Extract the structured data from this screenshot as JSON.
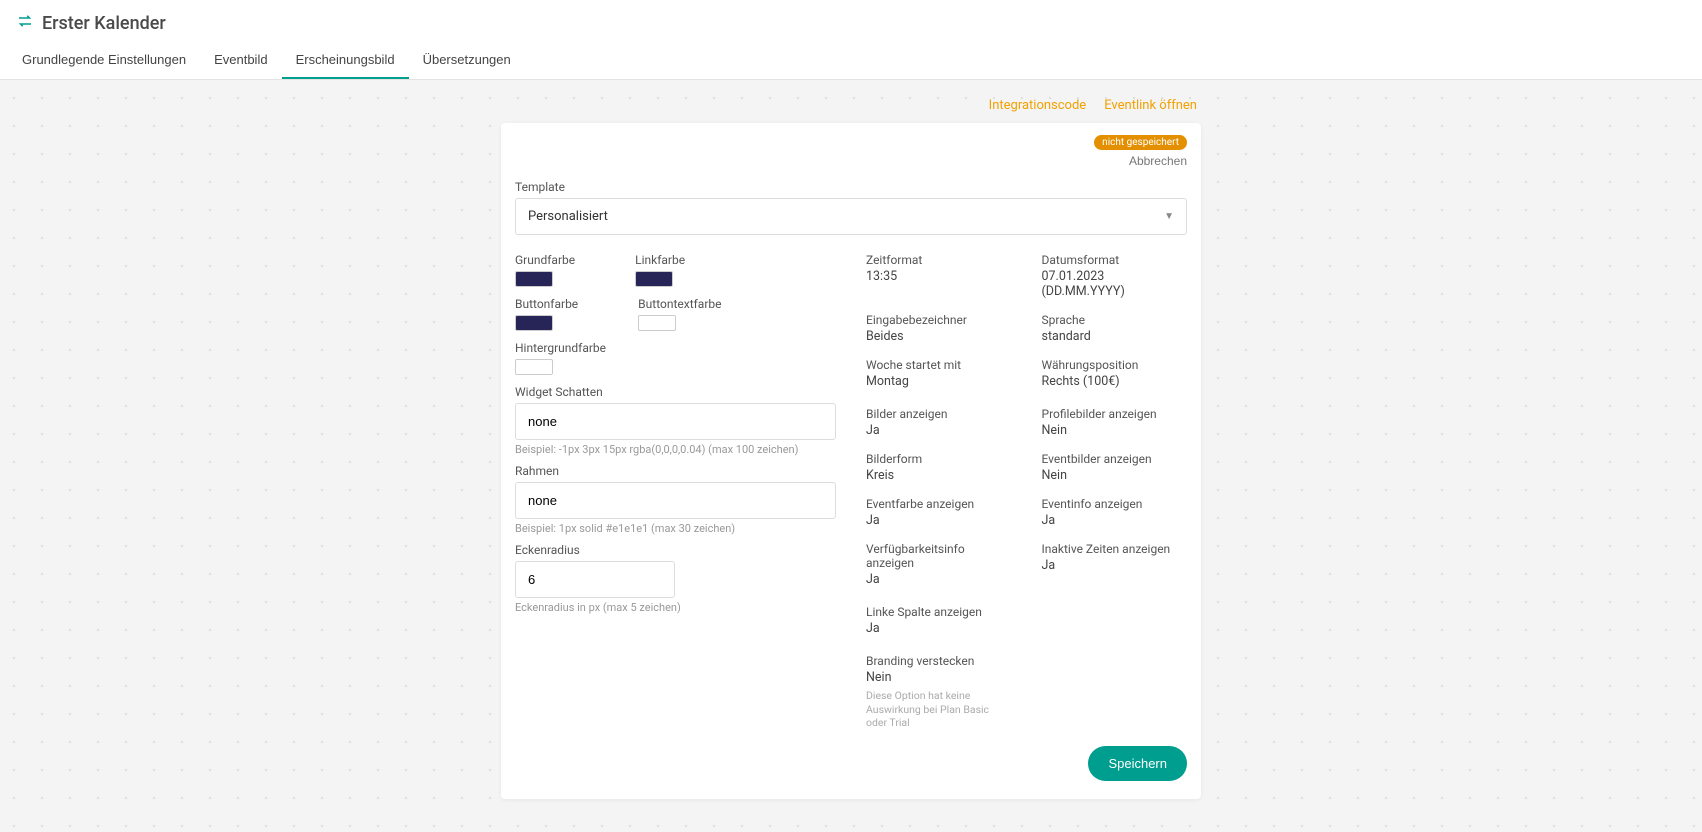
{
  "header": {
    "title": "Erster Kalender",
    "tabs": [
      {
        "label": "Grundlegende Einstellungen",
        "active": false
      },
      {
        "label": "Eventbild",
        "active": false
      },
      {
        "label": "Erscheinungsbild",
        "active": true
      },
      {
        "label": "Übersetzungen",
        "active": false
      }
    ]
  },
  "top_links": {
    "integration": "Integrationscode",
    "eventlink": "Eventlink öffnen"
  },
  "card": {
    "unsaved_badge": "nicht gespeichert",
    "cancel": "Abbrechen",
    "template_label": "Template",
    "template_value": "Personalisiert",
    "colors": {
      "grundfarbe_label": "Grundfarbe",
      "grundfarbe_value": "#272457",
      "linkfarbe_label": "Linkfarbe",
      "linkfarbe_value": "#272457",
      "buttonfarbe_label": "Buttonfarbe",
      "buttonfarbe_value": "#272457",
      "buttontextfarbe_label": "Buttontextfarbe",
      "buttontextfarbe_value": "#ffffff",
      "hintergrundfarbe_label": "Hintergrundfarbe",
      "hintergrundfarbe_value": "#ffffff"
    },
    "shadow": {
      "label": "Widget Schatten",
      "value": "none",
      "hint": "Beispiel: -1px 3px 15px rgba(0,0,0,0.04) (max 100 zeichen)"
    },
    "border": {
      "label": "Rahmen",
      "value": "none",
      "hint": "Beispiel: 1px solid #e1e1e1 (max 30 zeichen)"
    },
    "radius": {
      "label": "Eckenradius",
      "value": "6",
      "hint": "Eckenradius in px (max 5 zeichen)"
    },
    "right": {
      "group1": [
        {
          "label": "Zeitformat",
          "value": "13:35"
        },
        {
          "label": "Datumsformat",
          "value": "07.01.2023 (DD.MM.YYYY)"
        },
        {
          "label": "Eingabebezeichner",
          "value": "Beides"
        },
        {
          "label": "Sprache",
          "value": "standard"
        },
        {
          "label": "Woche startet mit",
          "value": "Montag"
        },
        {
          "label": "Währungsposition",
          "value": "Rechts (100€)"
        }
      ],
      "group2": [
        {
          "label": "Bilder anzeigen",
          "value": "Ja"
        },
        {
          "label": "Profilebilder anzeigen",
          "value": "Nein"
        },
        {
          "label": "Bilderform",
          "value": "Kreis"
        },
        {
          "label": "Eventbilder anzeigen",
          "value": "Nein"
        },
        {
          "label": "Eventfarbe anzeigen",
          "value": "Ja"
        },
        {
          "label": "Eventinfo anzeigen",
          "value": "Ja"
        },
        {
          "label": "Verfügbarkeitsinfo anzeigen",
          "value": "Ja"
        },
        {
          "label": "Inaktive Zeiten anzeigen",
          "value": "Ja"
        }
      ],
      "group3": [
        {
          "label": "Linke Spalte anzeigen",
          "value": "Ja"
        }
      ],
      "group4": [
        {
          "label": "Branding verstecken",
          "value": "Nein",
          "note": "Diese Option hat keine Auswirkung bei Plan Basic oder Trial"
        }
      ]
    },
    "save": "Speichern"
  }
}
